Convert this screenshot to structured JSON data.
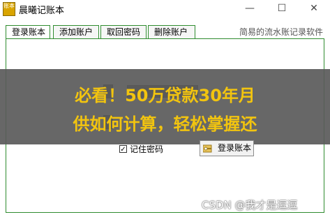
{
  "window": {
    "icon_text": "账本",
    "title": "晨曦记账本",
    "controls": {
      "minimize": "—",
      "maximize": "☐",
      "close": "✕"
    }
  },
  "tabs": [
    {
      "label": "登录账本",
      "active": true
    },
    {
      "label": "添加账户",
      "active": false
    },
    {
      "label": "取回密码",
      "active": false
    },
    {
      "label": "删除账户",
      "active": false
    }
  ],
  "header_note": "简易的流水账记录软件",
  "form": {
    "remember_label": "记住密码",
    "remember_checked": true,
    "login_button": "登录账本"
  },
  "overlay": {
    "line1": "必看！50万贷款30年月",
    "line2": "供如何计算，轻松掌握还"
  },
  "watermark": "CSDN @我才是逗逗",
  "colors": {
    "tab_border": "#2f8c2f",
    "banner_text": "#f2c40f",
    "banner_bg": "#5a5a5a"
  }
}
